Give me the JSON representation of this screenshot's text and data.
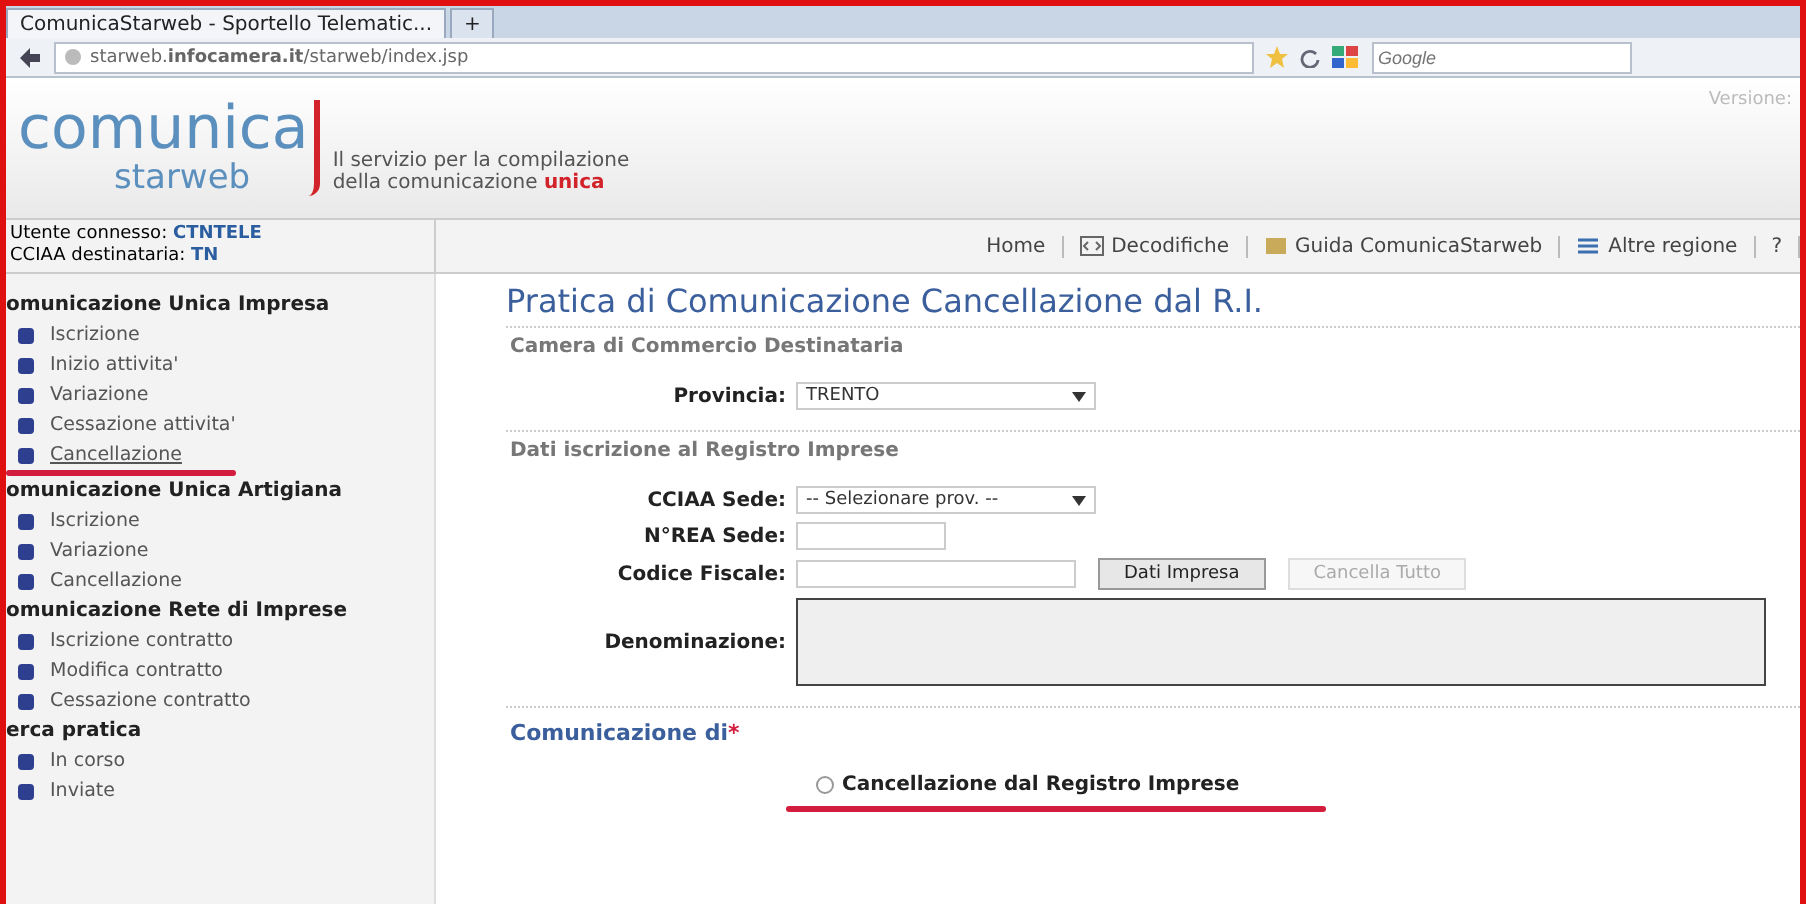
{
  "browser": {
    "tabs": [
      {
        "label": "ComunicaStarweb - Sportello Telematic...",
        "selected": true
      },
      {
        "label": "+",
        "selected": false
      }
    ],
    "address": "starweb.**infocamera.it**/starweb/index.jsp",
    "search_placeholder": "Google"
  },
  "header": {
    "logo_top": "comunica",
    "logo_bottom": "starweb",
    "tagline_1": "Il servizio per la compilazione",
    "tagline_2": "della comunicazione",
    "tagline_highlight": "unica",
    "version": "Versione:"
  },
  "user": {
    "label_1": "Utente connesso:",
    "value_1": "CTNTELE",
    "label_2": "CCIAA destinataria:",
    "value_2": "TN"
  },
  "toolbar": [
    {
      "label": "Home",
      "kind": "text"
    },
    {
      "label": "Decodifiche",
      "kind": "code"
    },
    {
      "label": "Guida ComunicaStarweb",
      "kind": "guide"
    },
    {
      "label": "Altre regione",
      "kind": "region"
    },
    {
      "label": "?",
      "kind": "help"
    }
  ],
  "sidebar": [
    {
      "title": "omunicazione Unica Impresa",
      "items": [
        {
          "label": "Iscrizione",
          "selected": false
        },
        {
          "label": "Inizio attivita'",
          "selected": false
        },
        {
          "label": "Variazione",
          "selected": false
        },
        {
          "label": "Cessazione attivita'",
          "selected": false
        },
        {
          "label": "Cancellazione",
          "selected": true
        }
      ]
    },
    {
      "title": "omunicazione Unica Artigiana",
      "items": [
        {
          "label": "Iscrizione",
          "selected": false
        },
        {
          "label": "Variazione",
          "selected": false
        },
        {
          "label": "Cancellazione",
          "selected": false
        }
      ]
    },
    {
      "title": "omunicazione Rete di Imprese",
      "items": [
        {
          "label": "Iscrizione contratto",
          "selected": false
        },
        {
          "label": "Modifica contratto",
          "selected": false
        },
        {
          "label": "Cessazione contratto",
          "selected": false
        }
      ]
    },
    {
      "title": "erca pratica",
      "items": [
        {
          "label": "In corso",
          "selected": false
        },
        {
          "label": "Inviate",
          "selected": false
        }
      ]
    }
  ],
  "main": {
    "title": "Pratica di Comunicazione Cancellazione dal R.I.",
    "section_1": "Camera di Commercio Destinataria",
    "provincia_label": "Provincia:",
    "provincia_value": "TRENTO",
    "section_2": "Dati iscrizione al Registro Imprese",
    "cciaa_label": "CCIAA Sede:",
    "cciaa_value": "-- Selezionare prov. --",
    "rea_label": "N°REA Sede:",
    "cf_label": "Codice Fiscale:",
    "denominazione_label": "Denominazione:",
    "buttons": [
      {
        "label": "Dati Impresa",
        "disabled": false
      },
      {
        "label": "Cancella Tutto",
        "disabled": true
      }
    ],
    "section_3": "Comunicazione di",
    "required_mark": "*",
    "options": [
      {
        "label": "Cancellazione dal Registro Imprese",
        "selected": false,
        "highlighted": true
      }
    ]
  }
}
